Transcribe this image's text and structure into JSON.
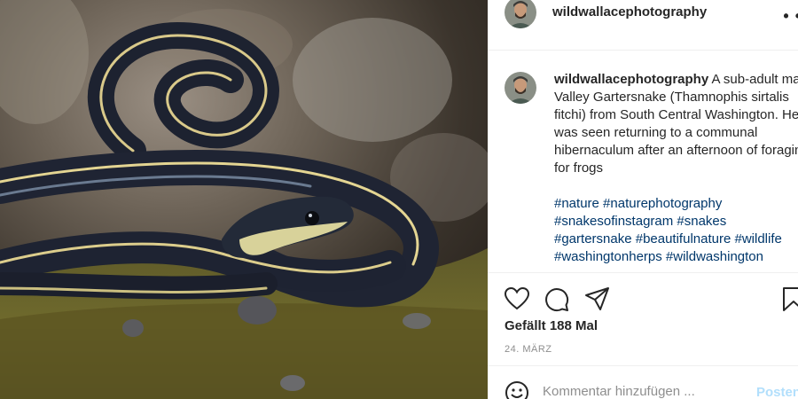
{
  "post": {
    "username": "wildwallacephotography",
    "caption": "A sub-adult male Valley Gartersnake (Thamnophis sirtalis fitchi) from South Central Washington. He was seen returning to a communal hibernaculum after an afternoon of foraging for frogs",
    "hashtags_lines": [
      "#nature #naturephotography",
      "#snakesofinstagram #snakes",
      "#gartersnake #beautifulnature #wildlife",
      "#washingtonherps #wildwashington"
    ],
    "likes": "Gefällt 188 Mal",
    "date": "24. MÄRZ",
    "comment_placeholder": "Kommentar hinzufügen ...",
    "post_label": "Posten"
  },
  "icons": {
    "more": "more-options-icon",
    "like": "heart-icon",
    "comment": "comment-icon",
    "share": "share-icon",
    "save": "bookmark-icon",
    "emoji": "emoji-icon"
  },
  "colors": {
    "hashtag": "#00376b",
    "post_button_disabled": "#b2dffc",
    "muted": "#8e8e8e"
  }
}
